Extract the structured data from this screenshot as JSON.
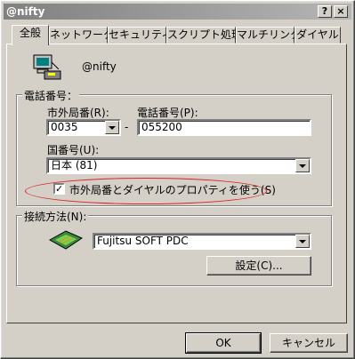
{
  "window": {
    "title": "@nifty"
  },
  "titlebar_buttons": {
    "help": "?",
    "close": "×"
  },
  "tabs": [
    "全般",
    "ネットワーク",
    "セキュリティ",
    "スクリプト処理",
    "マルチリンク",
    "ダイヤル"
  ],
  "connection": {
    "name": "@nifty"
  },
  "phone_group": {
    "label": "電話番号：",
    "area_code_label": "市外局番(R):",
    "area_code_value": "0035",
    "dash": "-",
    "phone_label": "電話番号(P):",
    "phone_value": "055200",
    "country_label": "国番号(U):",
    "country_value": "日本 (81)",
    "use_dialing_label": "市外局番とダイヤルのプロパティを使う(S)",
    "use_dialing_checked": true
  },
  "connect_group": {
    "label": "接続方法(N):",
    "device_value": "Fujitsu SOFT PDC",
    "settings_label": "設定(C)..."
  },
  "footer": {
    "ok_label": "OK",
    "cancel_label": "キャンセル"
  },
  "colors": {
    "highlight_ellipse": "#dd2222"
  }
}
